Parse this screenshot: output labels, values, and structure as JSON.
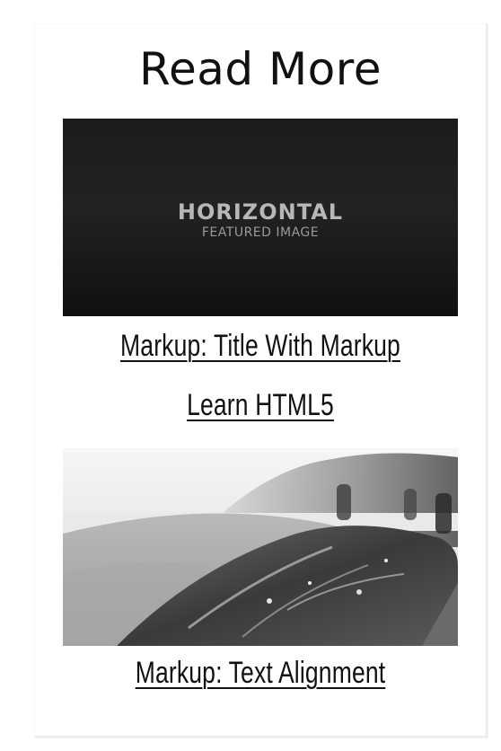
{
  "section": {
    "title": "Read More"
  },
  "posts": [
    {
      "title": "Markup: Title With Markup",
      "thumbnail": {
        "kind": "placeholder",
        "headline": "HORIZONTAL",
        "subline": "FEATURED IMAGE"
      }
    },
    {
      "title": "Learn HTML5"
    },
    {
      "title": "Markup: Text Alignment",
      "thumbnail": {
        "kind": "photo",
        "style": "black-and-white"
      }
    }
  ],
  "colors": {
    "text": "#111111",
    "card_border": "#ebebeb",
    "placeholder_bg": "#1c1c1c",
    "placeholder_text": "#b7b7b7"
  }
}
